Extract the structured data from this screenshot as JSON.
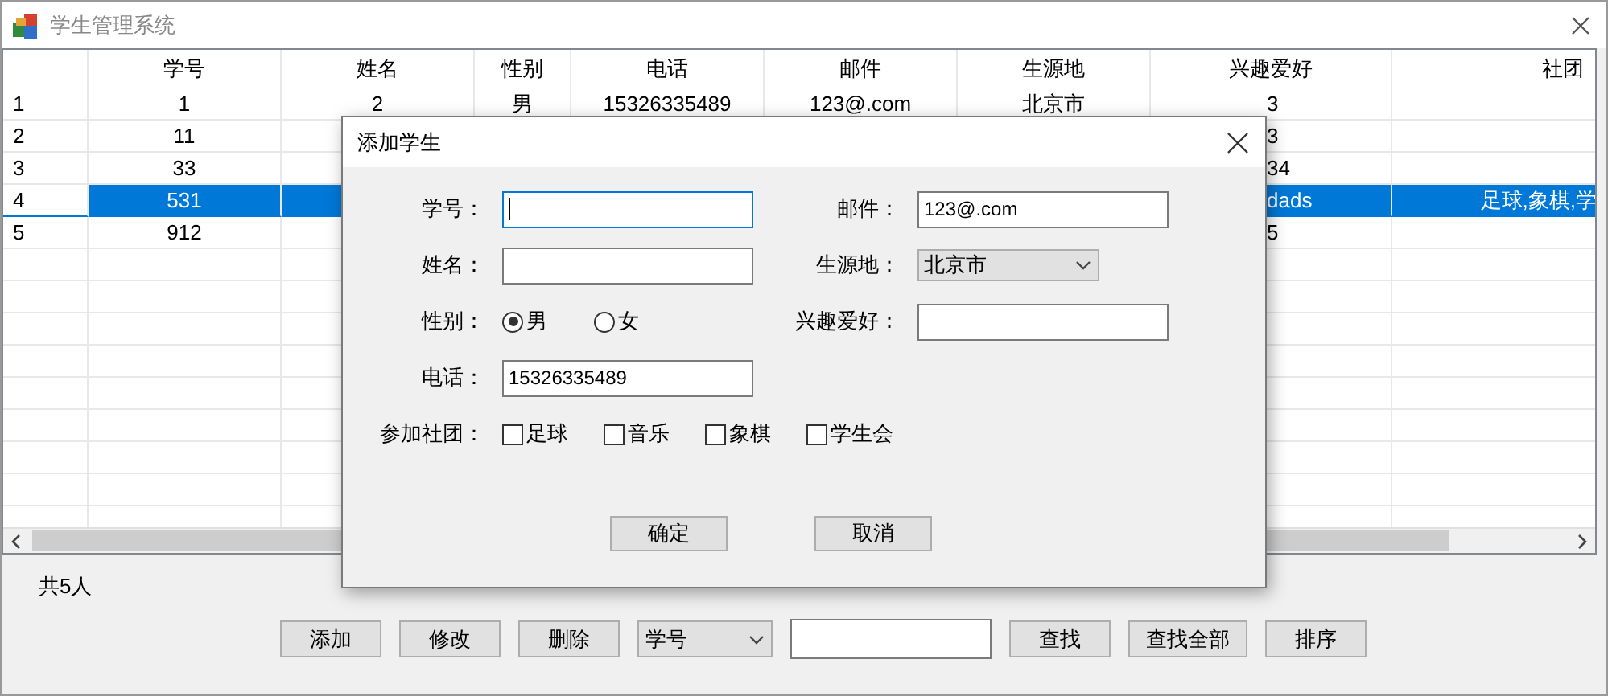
{
  "window": {
    "title": "学生管理系统"
  },
  "table": {
    "columns": [
      "学号",
      "姓名",
      "性别",
      "电话",
      "邮件",
      "生源地",
      "兴趣爱好",
      "社团"
    ],
    "rows": [
      {
        "header": "1",
        "selected": false,
        "cells": [
          "1",
          "2",
          "男",
          "15326335489",
          "123@.com",
          "北京市",
          "3",
          null
        ]
      },
      {
        "header": "2",
        "selected": false,
        "cells": [
          "11",
          null,
          null,
          null,
          null,
          null,
          "3",
          null
        ]
      },
      {
        "header": "3",
        "selected": false,
        "cells": [
          "33",
          null,
          null,
          null,
          null,
          null,
          "34",
          null
        ]
      },
      {
        "header": "4",
        "selected": true,
        "cells": [
          "531",
          null,
          null,
          null,
          null,
          null,
          "dads",
          "足球,象棋,学"
        ]
      },
      {
        "header": "5",
        "selected": false,
        "cells": [
          "912",
          null,
          null,
          null,
          null,
          null,
          "5",
          null
        ]
      }
    ]
  },
  "status": "共5人",
  "toolbar": [
    {
      "kind": "button",
      "label": "添加"
    },
    {
      "kind": "button",
      "label": "修改"
    },
    {
      "kind": "button",
      "label": "删除"
    },
    {
      "kind": "dropdown",
      "value": "学号"
    },
    {
      "kind": "field"
    },
    {
      "kind": "button",
      "label": "查找"
    },
    {
      "kind": "button",
      "label": "查找全部"
    },
    {
      "kind": "button",
      "label": "排序"
    }
  ],
  "dialog": {
    "title": "添加学生",
    "rows": [
      [
        {
          "label": "学号：",
          "kind": "text",
          "focused": true
        },
        {
          "label": "邮件：",
          "kind": "text",
          "value": "123@.com"
        }
      ],
      [
        {
          "label": "姓名：",
          "kind": "text"
        },
        {
          "label": "生源地：",
          "kind": "select",
          "value": "北京市"
        }
      ],
      [
        {
          "label": "性别：",
          "kind": "radio",
          "options": [
            {
              "label": "男",
              "selected": true
            },
            {
              "label": "女",
              "selected": false
            }
          ]
        },
        {
          "label": "兴趣爱好：",
          "kind": "text"
        }
      ],
      [
        {
          "label": "电话：",
          "kind": "text",
          "value": "15326335489"
        }
      ],
      [
        {
          "label": "参加社团：",
          "kind": "checks",
          "options": [
            {
              "label": "足球",
              "checked": false
            },
            {
              "label": "音乐",
              "checked": false
            },
            {
              "label": "象棋",
              "checked": false
            },
            {
              "label": "学生会",
              "checked": false
            }
          ]
        }
      ]
    ],
    "buttons": [
      "确定",
      "取消"
    ]
  }
}
